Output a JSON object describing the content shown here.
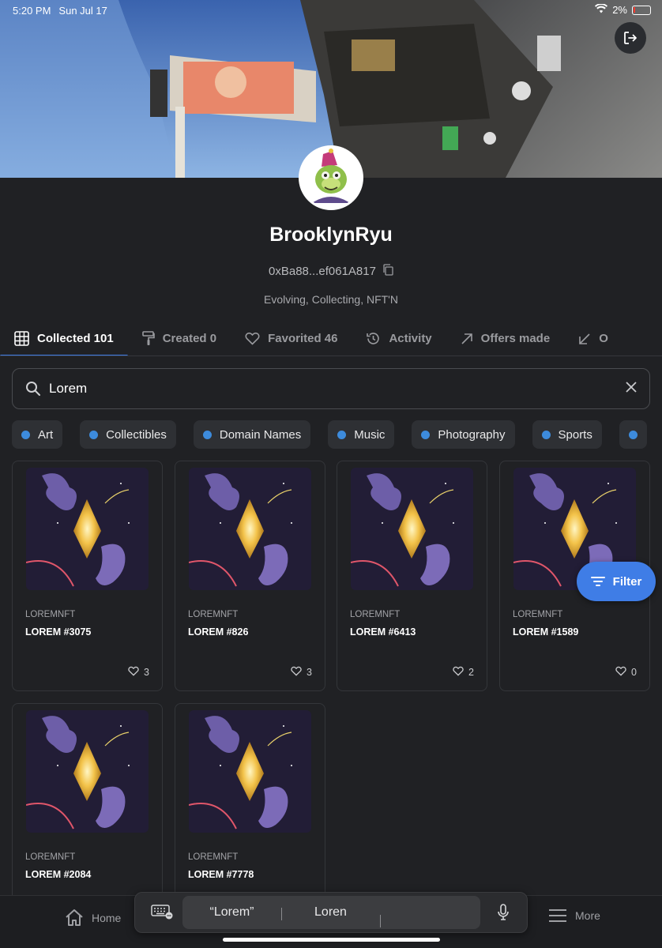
{
  "status_bar": {
    "time": "5:20 PM",
    "date": "Sun Jul 17",
    "battery": "2%"
  },
  "profile": {
    "username": "BrooklynRyu",
    "address": "0xBa88...ef061A817",
    "bio": "Evolving, Collecting, NFT'N"
  },
  "tabs": [
    {
      "label": "Collected 101",
      "icon": "grid-icon"
    },
    {
      "label": "Created 0",
      "icon": "paint-roller-icon"
    },
    {
      "label": "Favorited 46",
      "icon": "heart-icon"
    },
    {
      "label": "Activity",
      "icon": "history-icon"
    },
    {
      "label": "Offers made",
      "icon": "arrow-up-right-icon"
    },
    {
      "label": "O",
      "icon": "arrow-down-left-icon"
    }
  ],
  "search": {
    "value": "Lorem"
  },
  "categories": [
    "Art",
    "Collectibles",
    "Domain Names",
    "Music",
    "Photography",
    "Sports"
  ],
  "items": [
    {
      "collection": "LOREMNFT",
      "name": "LOREM #3075",
      "favorites": "3"
    },
    {
      "collection": "LOREMNFT",
      "name": "LOREM #826",
      "favorites": "3"
    },
    {
      "collection": "LOREMNFT",
      "name": "LOREM #6413",
      "favorites": "2"
    },
    {
      "collection": "LOREMNFT",
      "name": "LOREM #1589",
      "favorites": "0"
    },
    {
      "collection": "LOREMNFT",
      "name": "LOREM #2084",
      "favorites": ""
    },
    {
      "collection": "LOREMNFT",
      "name": "LOREM #7778",
      "favorites": ""
    }
  ],
  "filter_label": "Filter",
  "bottom_nav": {
    "home": "Home",
    "more": "More"
  },
  "keyboard": {
    "suggestions": [
      "“Lorem”",
      "Loren",
      ""
    ]
  },
  "colors": {
    "accent": "#3f7de6",
    "background": "#202124"
  }
}
